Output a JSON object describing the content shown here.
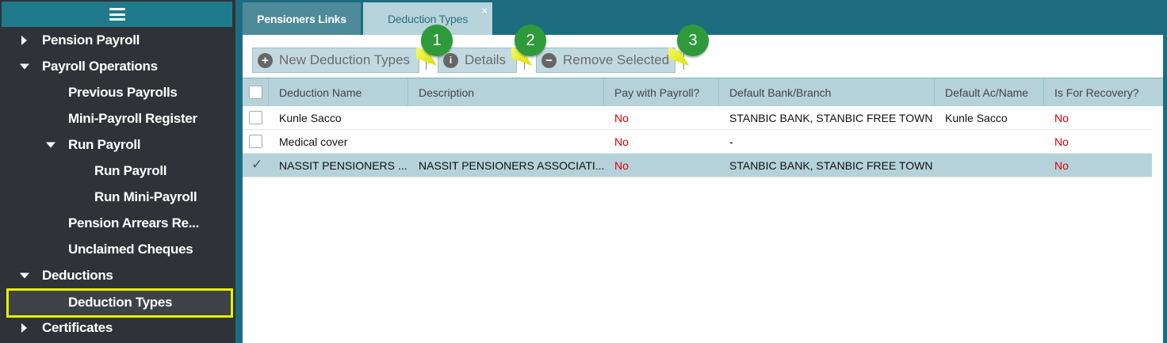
{
  "sidebar": {
    "items": [
      {
        "label": "Pension Payroll"
      },
      {
        "label": "Payroll Operations"
      },
      {
        "label": "Previous Payrolls"
      },
      {
        "label": "Mini-Payroll Register"
      },
      {
        "label": "Run Payroll"
      },
      {
        "label": "Run Payroll"
      },
      {
        "label": "Run Mini-Payroll"
      },
      {
        "label": "Pension Arrears Re..."
      },
      {
        "label": "Unclaimed Cheques"
      },
      {
        "label": "Deductions"
      },
      {
        "label": "Deduction Types"
      },
      {
        "label": "Certificates"
      }
    ]
  },
  "tabs": [
    {
      "label": "Pensioners Links"
    },
    {
      "label": "Deduction Types",
      "close": "×"
    }
  ],
  "toolbar": {
    "new_label": "New Deduction Types",
    "details_label": "Details",
    "remove_label": "Remove Selected",
    "markers": [
      "1",
      "2",
      "3"
    ]
  },
  "grid": {
    "columns": [
      "Deduction Name",
      "Description",
      "Pay with Payroll?",
      "Default Bank/Branch",
      "Default Ac/Name",
      "Is For Recovery?"
    ],
    "rows": [
      {
        "name": "Kunle Sacco",
        "description": "",
        "pay": "No",
        "bank": "STANBIC BANK, STANBIC FREE TOWN",
        "acname": "Kunle Sacco",
        "recovery": "No",
        "checked": false
      },
      {
        "name": "Medical cover",
        "description": "",
        "pay": "No",
        "bank": "-",
        "acname": "",
        "recovery": "No",
        "checked": false
      },
      {
        "name": "NASSIT PENSIONERS ...",
        "description": "NASSIT PENSIONERS ASSOCIATI...",
        "pay": "No",
        "bank": "STANBIC BANK, STANBIC FREE TOWN",
        "acname": "",
        "recovery": "No",
        "checked": true
      }
    ]
  },
  "colors": {
    "accent": "#1d6c80",
    "highlight": "#e8f000",
    "marker": "#2e9a3a",
    "negative": "#e00000"
  }
}
